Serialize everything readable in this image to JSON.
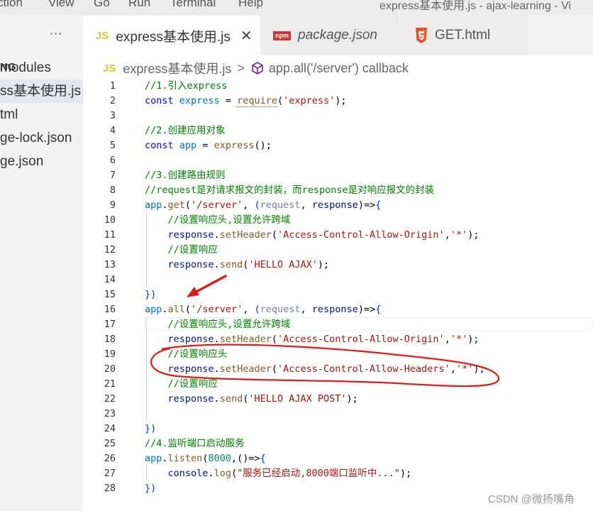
{
  "menubar": {
    "items": [
      "ction",
      "View",
      "Go",
      "Run",
      "Terminal",
      "Help"
    ],
    "window_title": "express基本使用.js - ajax-learning - Vi"
  },
  "sidebar": {
    "more": "···",
    "header": "NG",
    "items": [
      {
        "label": "modules",
        "active": false
      },
      {
        "label": "ss基本使用.js",
        "active": true
      },
      {
        "label": "tml",
        "active": false
      },
      {
        "label": "ge-lock.json",
        "active": false
      },
      {
        "label": "ge.json",
        "active": false
      }
    ]
  },
  "tabs": [
    {
      "icon": "JS",
      "label": "express基本使用.js",
      "active": true,
      "close": "✕"
    },
    {
      "icon": "npm",
      "label": "package.json",
      "active": false
    },
    {
      "icon": "html5-icon",
      "label": "GET.html",
      "active": false
    }
  ],
  "breadcrumb": {
    "file_icon": "JS",
    "file": "express基本使用.js",
    "separator": ">",
    "symbol": "app.all('/server') callback"
  },
  "editor": {
    "current_line": 17,
    "lines": [
      {
        "n": "1",
        "tokens": [
          {
            "t": "//1.引入express",
            "c": "comment"
          }
        ]
      },
      {
        "n": "2",
        "tokens": [
          {
            "t": "const",
            "c": "keyword"
          },
          {
            "t": " ",
            "c": "punct"
          },
          {
            "t": "express",
            "c": "var"
          },
          {
            "t": " = ",
            "c": "punct"
          },
          {
            "t": "require",
            "c": "func",
            "sq": true
          },
          {
            "t": "(",
            "c": "punct"
          },
          {
            "t": "'express'",
            "c": "string"
          },
          {
            "t": ");",
            "c": "punct"
          }
        ]
      },
      {
        "n": "3",
        "tokens": []
      },
      {
        "n": "4",
        "tokens": [
          {
            "t": "//2.创建应用对象",
            "c": "comment"
          }
        ]
      },
      {
        "n": "5",
        "tokens": [
          {
            "t": "const",
            "c": "keyword"
          },
          {
            "t": " ",
            "c": "punct"
          },
          {
            "t": "app",
            "c": "var"
          },
          {
            "t": " = ",
            "c": "punct"
          },
          {
            "t": "express",
            "c": "func"
          },
          {
            "t": "();",
            "c": "punct"
          }
        ]
      },
      {
        "n": "6",
        "tokens": []
      },
      {
        "n": "7",
        "tokens": [
          {
            "t": "//3.创建路由规则",
            "c": "comment"
          }
        ]
      },
      {
        "n": "8",
        "tokens": [
          {
            "t": "//request是对请求报文的封装，而response是对响应报文的封装",
            "c": "comment"
          }
        ]
      },
      {
        "n": "9",
        "tokens": [
          {
            "t": "app",
            "c": "var"
          },
          {
            "t": ".",
            "c": "punct"
          },
          {
            "t": "get",
            "c": "func"
          },
          {
            "t": "(",
            "c": "punct"
          },
          {
            "t": "'/server'",
            "c": "string"
          },
          {
            "t": ", ",
            "c": "punct"
          },
          {
            "t": "(",
            "c": "brace"
          },
          {
            "t": "request",
            "c": "dim"
          },
          {
            "t": ", ",
            "c": "punct"
          },
          {
            "t": "response",
            "c": "param"
          },
          {
            "t": ")=>",
            "c": "punct"
          },
          {
            "t": "{",
            "c": "brace"
          }
        ]
      },
      {
        "n": "10",
        "tokens": [
          {
            "t": "    ",
            "c": "punct"
          },
          {
            "t": "//设置响应头,设置允许跨域",
            "c": "comment"
          }
        ]
      },
      {
        "n": "11",
        "tokens": [
          {
            "t": "    ",
            "c": "punct"
          },
          {
            "t": "response",
            "c": "param"
          },
          {
            "t": ".",
            "c": "punct"
          },
          {
            "t": "setHeader",
            "c": "func"
          },
          {
            "t": "(",
            "c": "punct"
          },
          {
            "t": "'Access-Control-Allow-Origin'",
            "c": "string"
          },
          {
            "t": ",",
            "c": "punct"
          },
          {
            "t": "'*'",
            "c": "string"
          },
          {
            "t": ");",
            "c": "punct"
          }
        ]
      },
      {
        "n": "12",
        "tokens": [
          {
            "t": "    ",
            "c": "punct"
          },
          {
            "t": "//设置响应",
            "c": "comment"
          }
        ]
      },
      {
        "n": "13",
        "tokens": [
          {
            "t": "    ",
            "c": "punct"
          },
          {
            "t": "response",
            "c": "param"
          },
          {
            "t": ".",
            "c": "punct"
          },
          {
            "t": "send",
            "c": "func"
          },
          {
            "t": "(",
            "c": "punct"
          },
          {
            "t": "'HELLO AJAX'",
            "c": "string"
          },
          {
            "t": ");",
            "c": "punct"
          }
        ]
      },
      {
        "n": "14",
        "tokens": []
      },
      {
        "n": "15",
        "tokens": [
          {
            "t": "})",
            "c": "brace"
          }
        ]
      },
      {
        "n": "16",
        "tokens": [
          {
            "t": "app",
            "c": "var"
          },
          {
            "t": ".",
            "c": "punct"
          },
          {
            "t": "all",
            "c": "func"
          },
          {
            "t": "(",
            "c": "punct"
          },
          {
            "t": "'/server'",
            "c": "string"
          },
          {
            "t": ", ",
            "c": "punct"
          },
          {
            "t": "(",
            "c": "brace"
          },
          {
            "t": "request",
            "c": "dim"
          },
          {
            "t": ", ",
            "c": "punct"
          },
          {
            "t": "response",
            "c": "param"
          },
          {
            "t": ")=>",
            "c": "punct"
          },
          {
            "t": "{",
            "c": "brace"
          }
        ]
      },
      {
        "n": "17",
        "tokens": [
          {
            "t": "    ",
            "c": "punct"
          },
          {
            "t": "//设置响应头,设置允许跨域",
            "c": "comment"
          }
        ]
      },
      {
        "n": "18",
        "tokens": [
          {
            "t": "    ",
            "c": "punct"
          },
          {
            "t": "response",
            "c": "param"
          },
          {
            "t": ".",
            "c": "punct"
          },
          {
            "t": "setHeader",
            "c": "func"
          },
          {
            "t": "(",
            "c": "punct"
          },
          {
            "t": "'Access-Control-Allow-Origin'",
            "c": "string"
          },
          {
            "t": ",",
            "c": "punct"
          },
          {
            "t": "'*'",
            "c": "string"
          },
          {
            "t": ");",
            "c": "punct"
          }
        ]
      },
      {
        "n": "19",
        "tokens": [
          {
            "t": "    ",
            "c": "punct"
          },
          {
            "t": "//设置响应头",
            "c": "comment"
          }
        ]
      },
      {
        "n": "20",
        "tokens": [
          {
            "t": "    ",
            "c": "punct"
          },
          {
            "t": "response",
            "c": "param"
          },
          {
            "t": ".",
            "c": "punct"
          },
          {
            "t": "setHeader",
            "c": "func"
          },
          {
            "t": "(",
            "c": "punct"
          },
          {
            "t": "'Access-Control-Allow-Headers'",
            "c": "string"
          },
          {
            "t": ",",
            "c": "punct"
          },
          {
            "t": "'*'",
            "c": "string"
          },
          {
            "t": ");",
            "c": "punct"
          }
        ]
      },
      {
        "n": "21",
        "tokens": [
          {
            "t": "    ",
            "c": "punct"
          },
          {
            "t": "//设置响应",
            "c": "comment"
          }
        ]
      },
      {
        "n": "22",
        "tokens": [
          {
            "t": "    ",
            "c": "punct"
          },
          {
            "t": "response",
            "c": "param"
          },
          {
            "t": ".",
            "c": "punct"
          },
          {
            "t": "send",
            "c": "func"
          },
          {
            "t": "(",
            "c": "punct"
          },
          {
            "t": "'HELLO AJAX POST'",
            "c": "string"
          },
          {
            "t": ");",
            "c": "punct"
          }
        ]
      },
      {
        "n": "23",
        "tokens": []
      },
      {
        "n": "24",
        "tokens": [
          {
            "t": "})",
            "c": "brace"
          }
        ]
      },
      {
        "n": "25",
        "tokens": [
          {
            "t": "//4.监听端口启动服务",
            "c": "comment"
          }
        ]
      },
      {
        "n": "26",
        "tokens": [
          {
            "t": "app",
            "c": "var"
          },
          {
            "t": ".",
            "c": "punct"
          },
          {
            "t": "listen",
            "c": "func"
          },
          {
            "t": "(",
            "c": "punct"
          },
          {
            "t": "8000",
            "c": "num"
          },
          {
            "t": ",",
            "c": "punct"
          },
          {
            "t": "()=>",
            "c": "punct"
          },
          {
            "t": "{",
            "c": "brace"
          }
        ]
      },
      {
        "n": "27",
        "tokens": [
          {
            "t": "    ",
            "c": "punct"
          },
          {
            "t": "console",
            "c": "param"
          },
          {
            "t": ".",
            "c": "punct"
          },
          {
            "t": "log",
            "c": "func"
          },
          {
            "t": "(",
            "c": "punct"
          },
          {
            "t": "\"服务已经启动,",
            "c": "string"
          },
          {
            "t": "8000端口监听中...\"",
            "c": "string"
          },
          {
            "t": ");",
            "c": "punct"
          }
        ]
      },
      {
        "n": "28",
        "tokens": [
          {
            "t": "})",
            "c": "brace"
          }
        ]
      }
    ]
  },
  "colors": {
    "annotation_red": "#e01b1b"
  },
  "watermark": "CSDN @微扬嘴角"
}
